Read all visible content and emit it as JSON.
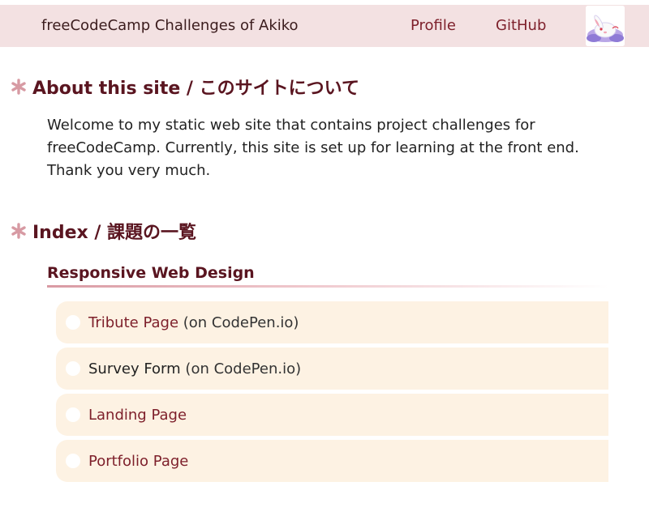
{
  "header": {
    "site_title": "freeCodeCamp Challenges of Akiko",
    "nav": {
      "profile": "Profile",
      "github": "GitHub"
    },
    "avatar_icon": "rabbit-avatar-icon"
  },
  "about": {
    "heading": "About this site / このサイトについて",
    "body": "Welcome to my static web site that contains project challenges for freeCodeCamp. Currently, this site is set up for learning at the front end. Thank you very much."
  },
  "index": {
    "heading": "Index / 課題の一覧",
    "category": "Responsive Web Design",
    "items": [
      {
        "title": "Tribute Page",
        "note": "(on CodePen.io)",
        "linked": true
      },
      {
        "title": "Survey Form",
        "note": "(on CodePen.io)",
        "linked": false
      },
      {
        "title": "Landing Page",
        "note": "",
        "linked": true
      },
      {
        "title": "Portfolio Page",
        "note": "",
        "linked": true
      }
    ]
  },
  "colors": {
    "header_bg": "#f3e1e2",
    "accent": "#7d1f2a",
    "heading": "#5a1520",
    "asterisk": "#d79aa3",
    "card_bg": "#fdf2e3"
  }
}
